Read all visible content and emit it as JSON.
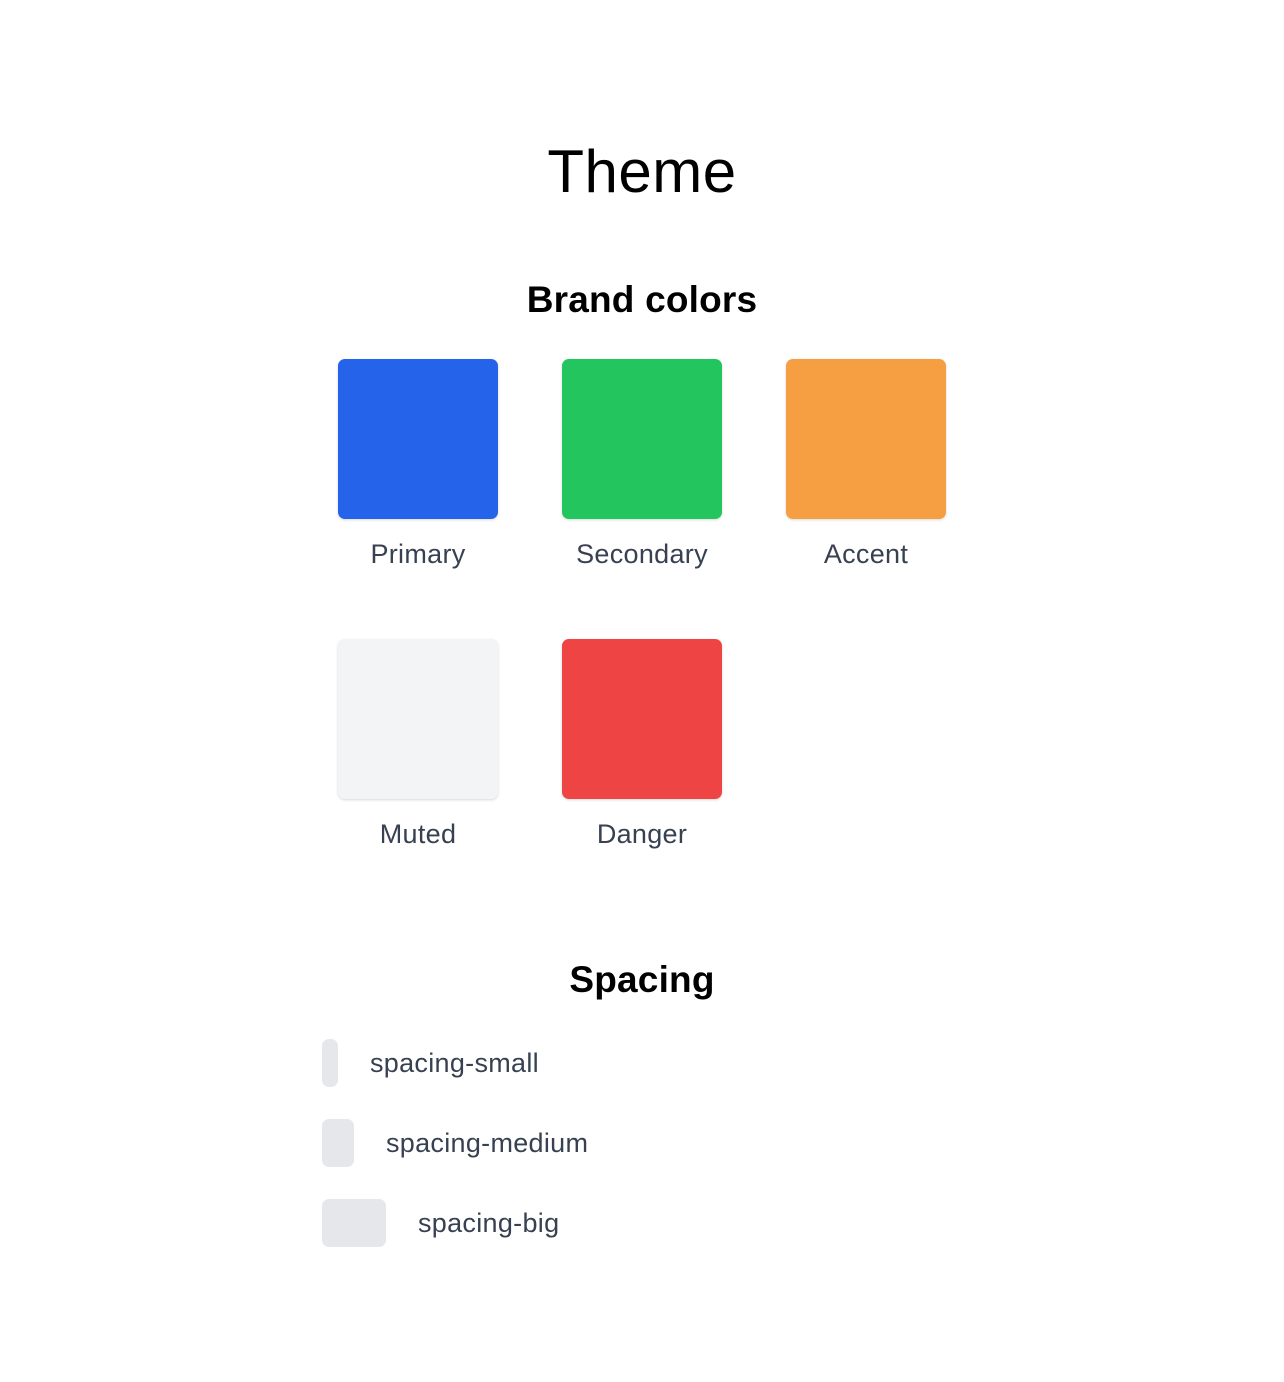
{
  "page": {
    "title": "Theme"
  },
  "brand_colors": {
    "heading": "Brand colors",
    "swatches": [
      {
        "label": "Primary",
        "color": "#2563eb"
      },
      {
        "label": "Secondary",
        "color": "#22c55e"
      },
      {
        "label": "Accent",
        "color": "#f59e42"
      },
      {
        "label": "Muted",
        "color": "#f3f4f6"
      },
      {
        "label": "Danger",
        "color": "#ef4444"
      }
    ]
  },
  "spacing": {
    "heading": "Spacing",
    "items": [
      {
        "label": "spacing-small"
      },
      {
        "label": "spacing-medium"
      },
      {
        "label": "spacing-big"
      }
    ],
    "bar_color": "#e5e7eb"
  }
}
